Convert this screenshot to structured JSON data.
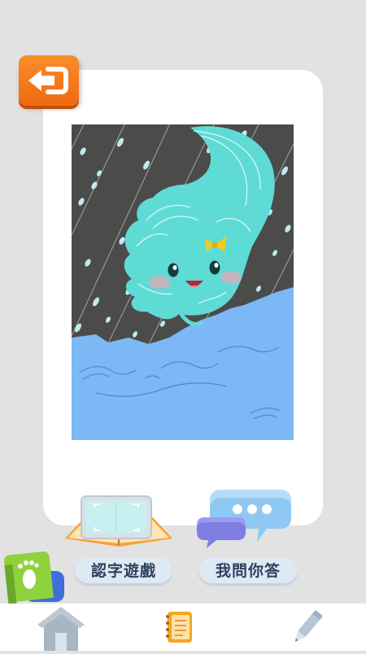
{
  "header": {
    "back_icon": "back-arrow-icon",
    "accent_color": "#f26e12"
  },
  "story": {
    "illustration": "cloud-ghost-in-rain-over-water",
    "colors": {
      "sky": "#4b4b49",
      "spirit": "#5fdbd6",
      "water": "#7cb8f5",
      "bow": "#f5cc1a"
    }
  },
  "games": [
    {
      "label": "認字遊戲",
      "icon": "open-book-icon"
    },
    {
      "label": "我問你答",
      "icon": "chat-bubbles-icon"
    }
  ],
  "side_tab": {
    "icon": "footprint-icon"
  },
  "bottom_nav": [
    {
      "icon": "home-icon"
    },
    {
      "icon": "notebook-icon"
    },
    {
      "icon": "pencil-icon"
    }
  ]
}
